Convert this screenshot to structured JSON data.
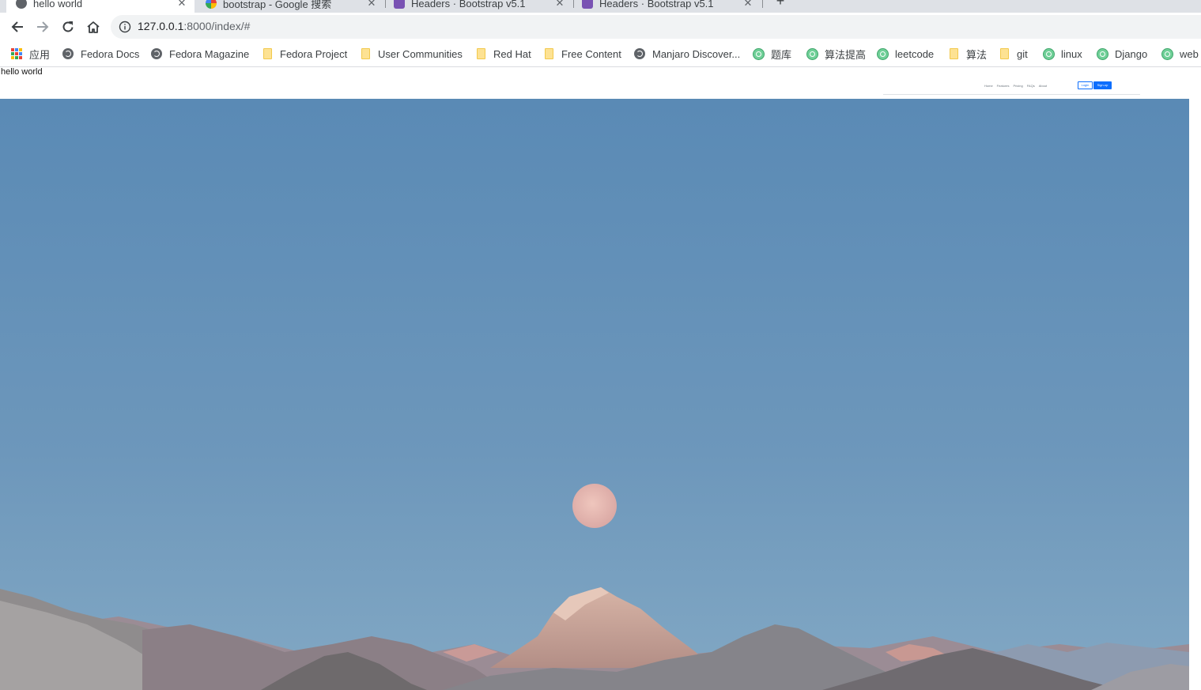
{
  "browser": {
    "tabs": [
      {
        "title": "hello world",
        "active": true,
        "favicon": "globe-icon"
      },
      {
        "title": "bootstrap - Google 搜索",
        "active": false,
        "favicon": "google-icon"
      },
      {
        "title": "Headers · Bootstrap v5.1",
        "active": false,
        "favicon": "bootstrap-icon"
      },
      {
        "title": "Headers · Bootstrap v5.1",
        "active": false,
        "favicon": "bootstrap-icon"
      }
    ],
    "newtab_label": "+",
    "close_glyph": "✕",
    "url_host": "127.0.0.1",
    "url_rest": ":8000/index/#"
  },
  "bookmarks": [
    {
      "label": "应用",
      "icon": "apps-grid-icon"
    },
    {
      "label": "Fedora Docs",
      "icon": "globe-icon"
    },
    {
      "label": "Fedora Magazine",
      "icon": "globe-icon"
    },
    {
      "label": "Fedora Project",
      "icon": "folder-icon"
    },
    {
      "label": "User Communities",
      "icon": "folder-icon"
    },
    {
      "label": "Red Hat",
      "icon": "folder-icon"
    },
    {
      "label": "Free Content",
      "icon": "folder-icon"
    },
    {
      "label": "Manjaro Discover...",
      "icon": "globe-icon"
    },
    {
      "label": "题库",
      "icon": "green-site-icon"
    },
    {
      "label": "算法提高",
      "icon": "green-site-icon"
    },
    {
      "label": "leetcode",
      "icon": "green-site-icon"
    },
    {
      "label": "算法",
      "icon": "folder-icon"
    },
    {
      "label": "git",
      "icon": "folder-icon"
    },
    {
      "label": "linux",
      "icon": "green-site-icon"
    },
    {
      "label": "Django",
      "icon": "green-site-icon"
    },
    {
      "label": "web",
      "icon": "green-site-icon"
    }
  ],
  "page": {
    "hello_text": "hello world",
    "header_nav": [
      "Home",
      "Features",
      "Pricing",
      "FAQs",
      "About"
    ],
    "login_label": "Login",
    "signup_label": "Sign-up",
    "hero_image": "full-moon-over-mountains-photo"
  },
  "colors": {
    "accent": "#0d6efd",
    "sky_top": "#5b8bb6",
    "sky_bottom": "#7ba4c2",
    "moon": "#e6b8b0"
  }
}
